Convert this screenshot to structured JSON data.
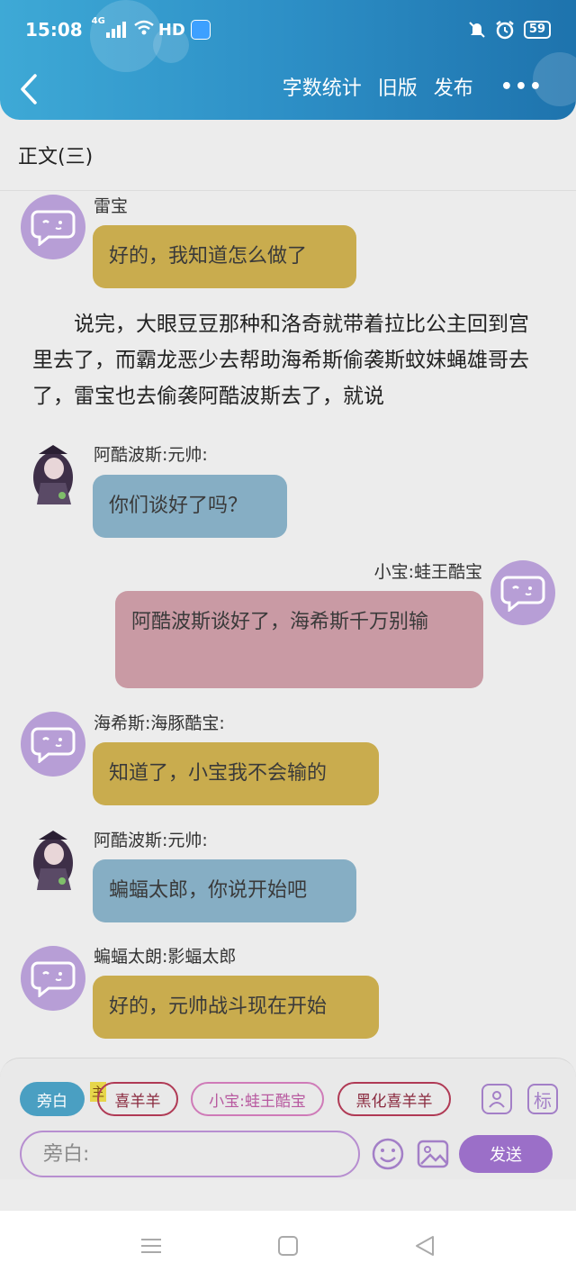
{
  "status_bar": {
    "time": "15:08",
    "network": "4G",
    "hd": "HD",
    "battery": "59"
  },
  "toolbar": {
    "word_count": "字数统计",
    "old_version": "旧版",
    "publish": "发布",
    "more": "•••"
  },
  "section": {
    "title": "正文(三)"
  },
  "messages": [
    {
      "name": "雷宝",
      "text": "好的，我知道怎么做了"
    },
    {
      "name": "阿酷波斯:元帅:",
      "text": "你们谈好了吗？"
    },
    {
      "name": "小宝:蛙王酷宝",
      "text": "阿酷波斯谈好了，海希斯千万别输"
    },
    {
      "name": "海希斯:海豚酷宝:",
      "text": "知道了，小宝我不会输的"
    },
    {
      "name": "阿酷波斯:元帅:",
      "text": "蝙蝠太郎，你说开始吧"
    },
    {
      "name": "蝙蝠太朗:影蝠太郎",
      "text": "好的，元帅战斗现在开始"
    }
  ],
  "narration": "说完，大眼豆豆那种和洛奇就带着拉比公主回到宫里去了，而霸龙恶少去帮助海希斯偷袭斯蚊妹蝇雄哥去了，雷宝也去偷袭阿酷波斯去了，就说",
  "roles": {
    "narrator": "旁白",
    "main_badge": "主",
    "items": [
      "喜羊羊",
      "小宝:蛙王酷宝",
      "黑化喜羊羊"
    ],
    "icon_mark": "标"
  },
  "composer": {
    "placeholder": "旁白:",
    "send": "发送"
  },
  "colors": {
    "header": "#2d8fc6",
    "yellow_bubble": "#c9ac4e",
    "blue_bubble": "#86aec4",
    "pink_bubble": "#c99aa4",
    "send": "#9b6fc8"
  }
}
